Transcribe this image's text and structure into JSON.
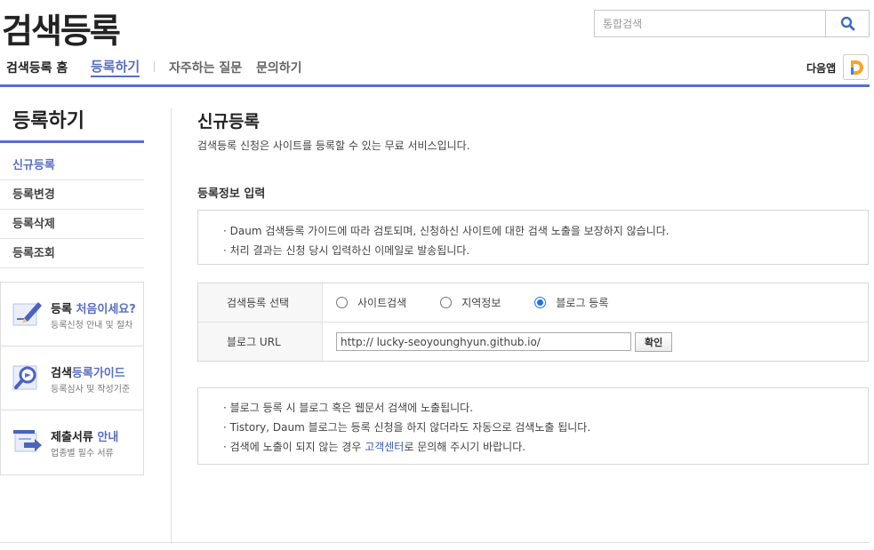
{
  "header": {
    "logo": "검색등록",
    "search_placeholder": "통합검색",
    "search_icon": "search-icon"
  },
  "gnb": {
    "home": "검색등록 홈",
    "register": "등록하기",
    "faq": "자주하는 질문",
    "inquiry": "문의하기",
    "daum_app": "다음앱",
    "daum_app_icon": "daum-app-icon"
  },
  "sidebar": {
    "title": "등록하기",
    "items": [
      {
        "label": "신규등록",
        "active": true
      },
      {
        "label": "등록변경",
        "active": false
      },
      {
        "label": "등록삭제",
        "active": false
      },
      {
        "label": "등록조회",
        "active": false
      }
    ],
    "banners": [
      {
        "title_a": "등록 ",
        "title_b": "처음이세요?",
        "title_c": "",
        "desc": "등록신청 안내 및 절차",
        "icon": "pencil-icon"
      },
      {
        "title_a": "검색",
        "title_b": "등록가이드",
        "title_c": "",
        "desc": "등록심사 및 작성기준",
        "icon": "magnifier-icon"
      },
      {
        "title_a": "제출서류 ",
        "title_b": "안내",
        "title_c": "",
        "desc": "업종별 필수 서류",
        "icon": "document-icon"
      }
    ]
  },
  "main": {
    "title": "신규등록",
    "desc": "검색등록 신청은 사이트를 등록할 수 있는 무료 서비스입니다.",
    "section_title": "등록정보 입력",
    "notice_top": [
      "· Daum 검색등록 가이드에 따라 검토되며, 신청하신 사이트에 대한 검색 노출을 보장하지 않습니다.",
      "· 처리 결과는 신청 당시 입력하신 이메일로 발송됩니다."
    ],
    "form": {
      "type_label": "검색등록 선택",
      "options": [
        {
          "label": "사이트검색",
          "checked": false
        },
        {
          "label": "지역정보",
          "checked": false
        },
        {
          "label": "블로그 등록",
          "checked": true
        }
      ],
      "url_label": "블로그 URL",
      "url_value": "http:// lucky-seoyounghyun.github.io/",
      "confirm_label": "확인"
    },
    "notice_bottom": {
      "line1": "· 블로그 등록 시 블로그 혹은 웹문서 검색에 노출됩니다.",
      "line2": "· Tistory, Daum 블로그는 등록 신청을 하지 않더라도 자동으로 검색노출 됩니다.",
      "line3_a": "· 검색에 노출이 되지 않는 경우 ",
      "line3_link": "고객센터",
      "line3_b": "로 문의해 주시기 바랍니다."
    }
  },
  "colors": {
    "accent": "#5a6ec4",
    "search_icon": "#3c6bc8",
    "radio_checked": "#1a73e8",
    "link": "#3b5bb5"
  }
}
